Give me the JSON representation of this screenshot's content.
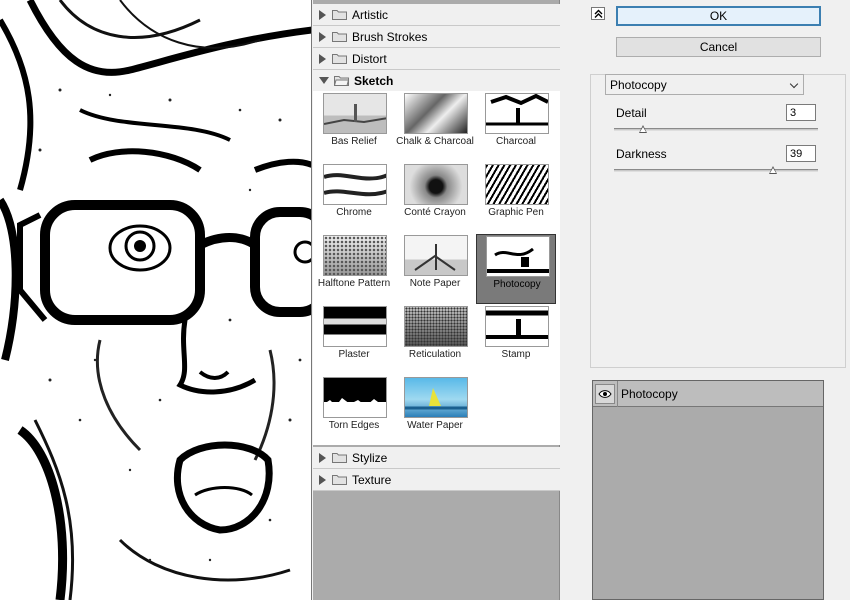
{
  "gallery": {
    "categories_top": [
      {
        "label": "Artistic",
        "expanded": false
      },
      {
        "label": "Brush Strokes",
        "expanded": false
      },
      {
        "label": "Distort",
        "expanded": false
      },
      {
        "label": "Sketch",
        "expanded": true
      }
    ],
    "categories_bottom": [
      {
        "label": "Stylize",
        "expanded": false
      },
      {
        "label": "Texture",
        "expanded": false
      }
    ],
    "filters": [
      {
        "label": "Bas Relief"
      },
      {
        "label": "Chalk & Charcoal"
      },
      {
        "label": "Charcoal"
      },
      {
        "label": "Chrome"
      },
      {
        "label": "Conté Crayon"
      },
      {
        "label": "Graphic Pen"
      },
      {
        "label": "Halftone Pattern"
      },
      {
        "label": "Note Paper"
      },
      {
        "label": "Photocopy",
        "selected": true
      },
      {
        "label": "Plaster"
      },
      {
        "label": "Reticulation"
      },
      {
        "label": "Stamp"
      },
      {
        "label": "Torn Edges"
      },
      {
        "label": "Water Paper"
      }
    ]
  },
  "buttons": {
    "ok": "OK",
    "cancel": "Cancel",
    "collapse_icon": "double-chevron-up"
  },
  "filter_settings": {
    "selected_filter": "Photocopy",
    "params": [
      {
        "label": "Detail",
        "value": "3",
        "fraction": 0.14
      },
      {
        "label": "Darkness",
        "value": "39",
        "fraction": 0.78
      }
    ]
  },
  "effect_layers": {
    "active": "Photocopy",
    "icon": "eye-icon"
  },
  "colors": {
    "selection": "#7a7a7a",
    "panel_bg": "#f0f0f0",
    "empty_area": "#ababab",
    "ok_border": "#3c7fb1"
  }
}
